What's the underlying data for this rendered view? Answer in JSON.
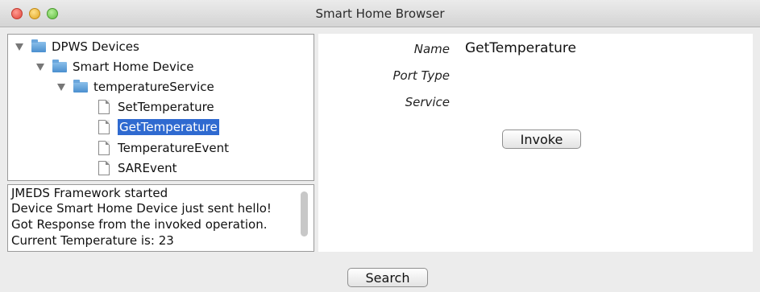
{
  "window": {
    "title": "Smart Home Browser"
  },
  "tree": {
    "root": "DPWS Devices",
    "device": "Smart Home Device",
    "service": "temperatureService",
    "operations": [
      "SetTemperature",
      "GetTemperature",
      "TemperatureEvent",
      "SAREvent"
    ],
    "selected": "GetTemperature"
  },
  "log": {
    "lines": [
      "JMEDS Framework started",
      "Device Smart Home Device just sent hello!",
      "Got Response from the invoked operation.",
      "Current Temperature is: 23"
    ]
  },
  "details": {
    "name_label": "Name",
    "name_value": "GetTemperature",
    "port_type_label": "Port Type",
    "port_type_value": "",
    "service_label": "Service",
    "service_value": "",
    "invoke_label": "Invoke"
  },
  "footer": {
    "search_label": "Search"
  }
}
